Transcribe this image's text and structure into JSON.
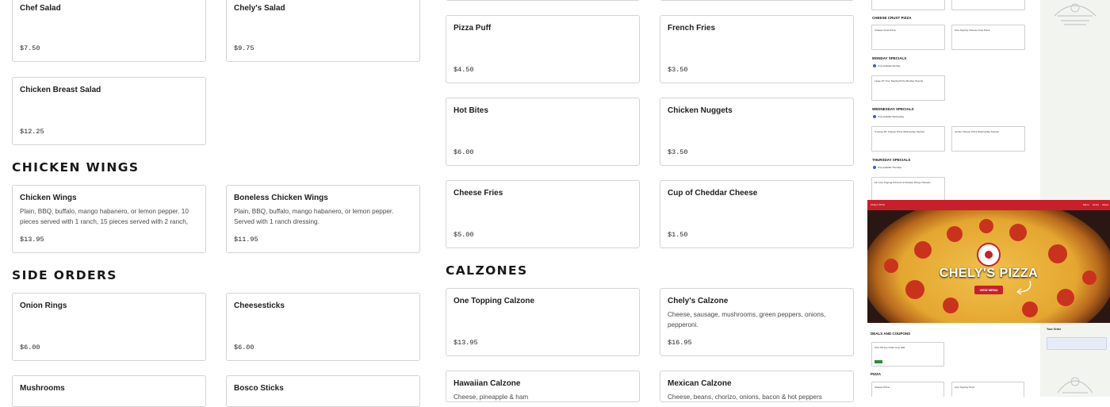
{
  "salads": {
    "items": [
      {
        "name": "Chef Salad",
        "price": "$7.50"
      },
      {
        "name": "Chely's Salad",
        "price": "$9.75"
      },
      {
        "name": "Chicken Breast Salad",
        "price": "$12.25"
      }
    ]
  },
  "chicken_wings": {
    "title": "CHICKEN WINGS",
    "items": [
      {
        "name": "Chicken Wings",
        "description": "Plain, BBQ, buffalo, mango habanero, or lemon pepper. 10 pieces served with 1 ranch, 15 pieces served with 2 ranch, 20...",
        "price": "$13.95"
      },
      {
        "name": "Boneless Chicken Wings",
        "description": "Plain, BBQ, buffalo, mango habanero, or lemon pepper. Served with 1 ranch dressing.",
        "price": "$11.95"
      }
    ]
  },
  "side_orders": {
    "title": "SIDE ORDERS",
    "items": [
      {
        "name": "Onion Rings",
        "price": "$6.00"
      },
      {
        "name": "Cheesesticks",
        "price": "$6.00"
      },
      {
        "name": "Mushrooms"
      },
      {
        "name": "Bosco Sticks"
      }
    ]
  },
  "sides_right": {
    "items": [
      {
        "name": "Pizza Puff",
        "price": "$4.50"
      },
      {
        "name": "French Fries",
        "price": "$3.50"
      },
      {
        "name": "Hot Bites",
        "price": "$6.00"
      },
      {
        "name": "Chicken Nuggets",
        "price": "$3.50"
      },
      {
        "name": "Cheese Fries",
        "price": "$5.00"
      },
      {
        "name": "Cup of Cheddar Cheese",
        "price": "$1.50"
      }
    ]
  },
  "calzones": {
    "title": "CALZONES",
    "items": [
      {
        "name": "One Topping Calzone",
        "price": "$13.95"
      },
      {
        "name": "Chely's Calzone",
        "description": "Cheese, sausage, mushrooms, green peppers, onions, pepperoni.",
        "price": "$16.95"
      },
      {
        "name": "Hawaiian Calzone",
        "description": "Cheese, pineapple & ham"
      },
      {
        "name": "Mexican Calzone",
        "description": "Cheese, beans, chorizo, onions, bacon & hot peppers"
      }
    ]
  },
  "preview": {
    "headings": [
      "CHEESE CRUST PIZZA",
      "MONDAY SPECIALS",
      "WEDNESDAY SPECIALS",
      "THURSDAY SPECIALS",
      "DEALS AND COUPONS",
      "PIZZA"
    ],
    "badges": [
      "Only available Monday",
      "Only available Wednesday",
      "Only available Thursday"
    ],
    "cards": [
      "Cheese Crust Pizza",
      "One Topping Cheese Crust Pizza",
      "Large 16\" One Topping Pizza Monday Special",
      "X-Large 18\" Cheese Pizza Wednesday Special",
      "Jumbo Cheese Pizza Wednesday Special",
      "16\" One Topping Pizza & 10 Chicken Wings Thursda...",
      "10% Off Any Order Over $30",
      "Cheese Pizza",
      "One Topping Pizza"
    ],
    "hero_title": "CHELY'S PIZZA",
    "hero_button": "VIEW MENU",
    "nav_brand": "Chely's Pizza",
    "nav_links": [
      "Menu",
      "Hours",
      "About"
    ],
    "your_order": "Your Order",
    "colors": {
      "brand_red": "#c8202a",
      "hero_bg": "#1a1010"
    }
  }
}
